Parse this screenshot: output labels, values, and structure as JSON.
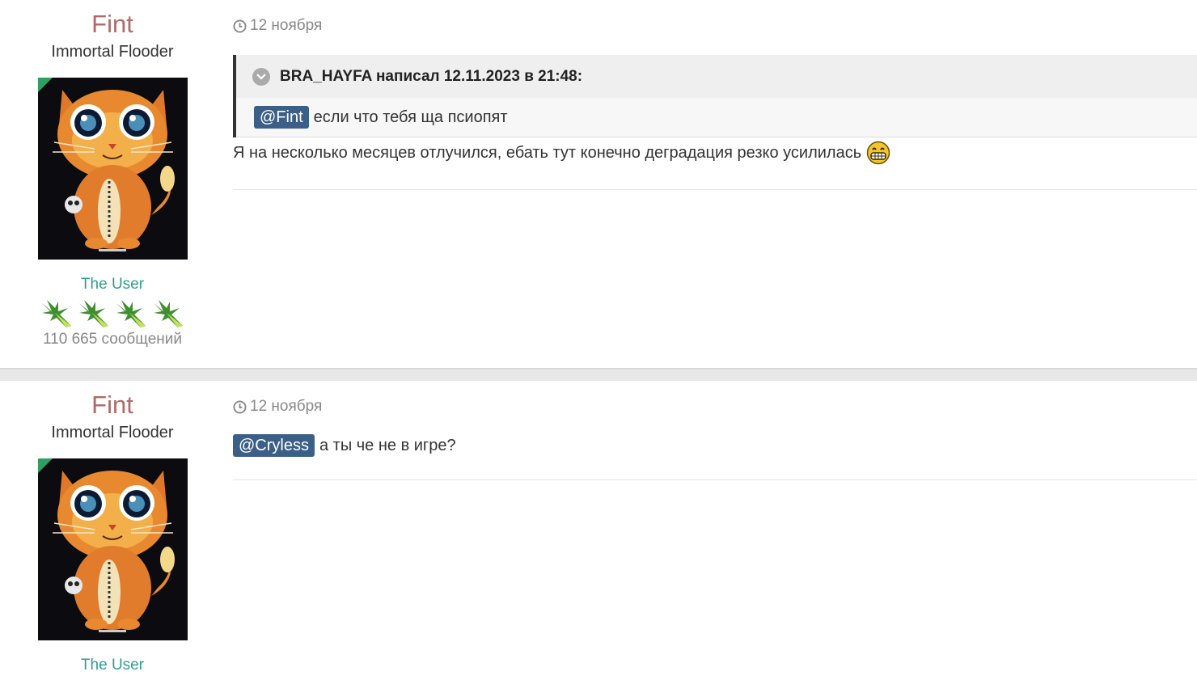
{
  "posts": [
    {
      "author": {
        "name": "Fint",
        "title": "Immortal Flooder",
        "group": "The User",
        "message_count": "110 665 сообщений"
      },
      "date": "12 ноября",
      "quote": {
        "header": "BRA_HAYFA написал 12.11.2023 в 21:48:",
        "mention": "@Fint",
        "text": "если что тебя ща псиопят"
      },
      "message": "Я на несколько месяцев отлучился, ебать тут конечно деградация резко усилилась"
    },
    {
      "author": {
        "name": "Fint",
        "title": "Immortal Flooder",
        "group": "The User"
      },
      "date": "12 ноября",
      "mention": "@Cryless",
      "message": "а ты че не в игре?"
    }
  ],
  "icons": {
    "clock": "clock-icon",
    "quote_toggle": "chevron-down-icon",
    "emoji": "grin-emoji-icon",
    "rank_star": "rank-star-icon"
  },
  "colors": {
    "author_name": "#b06a6a",
    "group": "#2f9e8f",
    "mention_bg": "#3b5f86",
    "online_marker": "#2e9e63"
  }
}
